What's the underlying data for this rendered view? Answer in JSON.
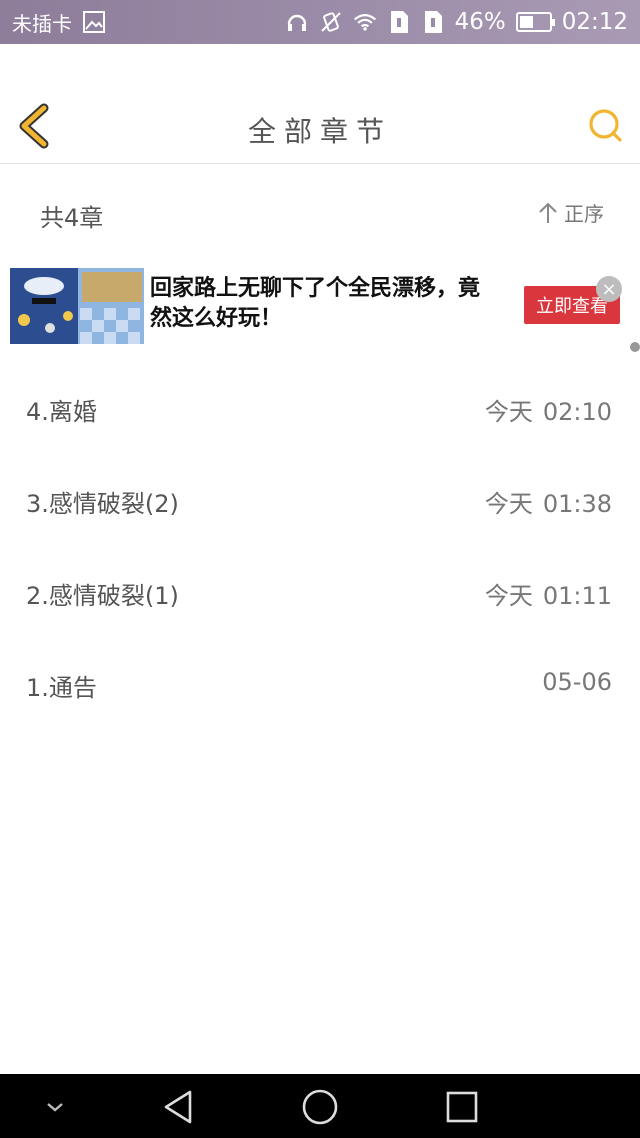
{
  "status_bar": {
    "carrier": "未插卡",
    "battery": "46%",
    "time": "02:12",
    "icons": [
      "image-icon",
      "headphones-icon",
      "vibrate-icon",
      "wifi-icon",
      "sim1-icon",
      "sim2-icon",
      "battery-icon"
    ]
  },
  "header": {
    "title": "全部章节",
    "back_icon": "chevron-left-icon",
    "search_icon": "search-icon",
    "accent": "#F2B531"
  },
  "info": {
    "chapter_count": "共4章",
    "sort_label": "正序"
  },
  "ad": {
    "text": "回家路上无聊下了个全民漂移，竟然这么好玩！",
    "cta": "立即查看",
    "cta_color": "#D9363E"
  },
  "chapters": [
    {
      "title": "4.离婚",
      "day": "今天",
      "time": "02:10"
    },
    {
      "title": "3.感情破裂(2)",
      "day": "今天",
      "time": "01:38"
    },
    {
      "title": "2.感情破裂(1)",
      "day": "今天",
      "time": "01:11"
    },
    {
      "title": "1.通告",
      "day": "",
      "time": "05-06"
    }
  ],
  "nav": {
    "icons": [
      "chevron-down-icon",
      "back-triangle-icon",
      "home-circle-icon",
      "recent-square-icon"
    ]
  }
}
